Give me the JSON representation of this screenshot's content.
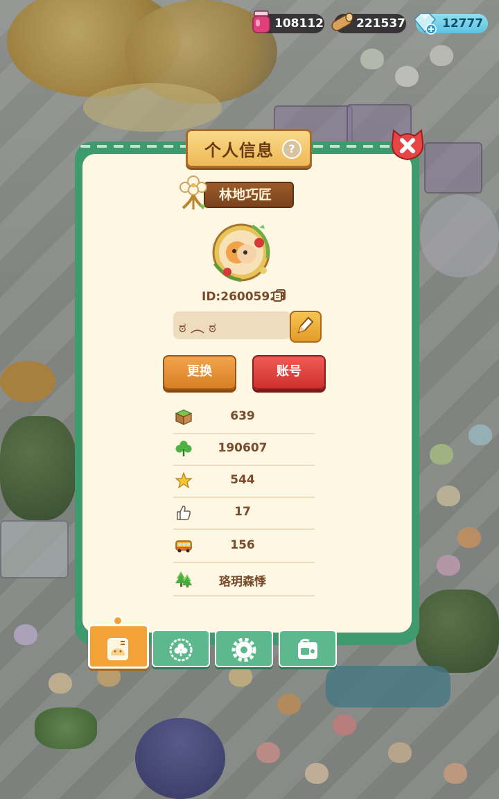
{
  "resources": [
    {
      "name": "jam-jar-icon",
      "value": "108112"
    },
    {
      "name": "wood-log-icon",
      "value": "221537"
    },
    {
      "name": "diamond-icon",
      "value": "12777"
    }
  ],
  "dialog": {
    "title": "个人信息",
    "help_label": "?",
    "rank_title": "林地巧匠",
    "player_id": "ID:26005923",
    "signature": "ಠ ︵ ಠ",
    "change_button": "更换",
    "account_button": "账号"
  },
  "stats": [
    {
      "icon": "grass-block-icon",
      "value": "639"
    },
    {
      "icon": "clover-icon",
      "value": "190607"
    },
    {
      "icon": "star-icon",
      "value": "544"
    },
    {
      "icon": "thumbs-up-icon",
      "value": "17"
    },
    {
      "icon": "bus-icon",
      "value": "156"
    },
    {
      "icon": "pine-tree-icon",
      "value": "珞玥森悸"
    }
  ],
  "tabs": [
    {
      "name": "tab-profile",
      "icon": "profile-card-icon",
      "active": true
    },
    {
      "name": "tab-badges",
      "icon": "clover-badge-icon",
      "active": false
    },
    {
      "name": "tab-settings",
      "icon": "gear-icon",
      "active": false
    },
    {
      "name": "tab-album",
      "icon": "photo-album-icon",
      "active": false
    }
  ],
  "colors": {
    "frame_green": "#3f9a6e",
    "panel_cream": "#fdf7e4",
    "text_brown": "#7a4b2a",
    "accent_orange": "#f2a236",
    "accent_red": "#cf2f2f"
  }
}
